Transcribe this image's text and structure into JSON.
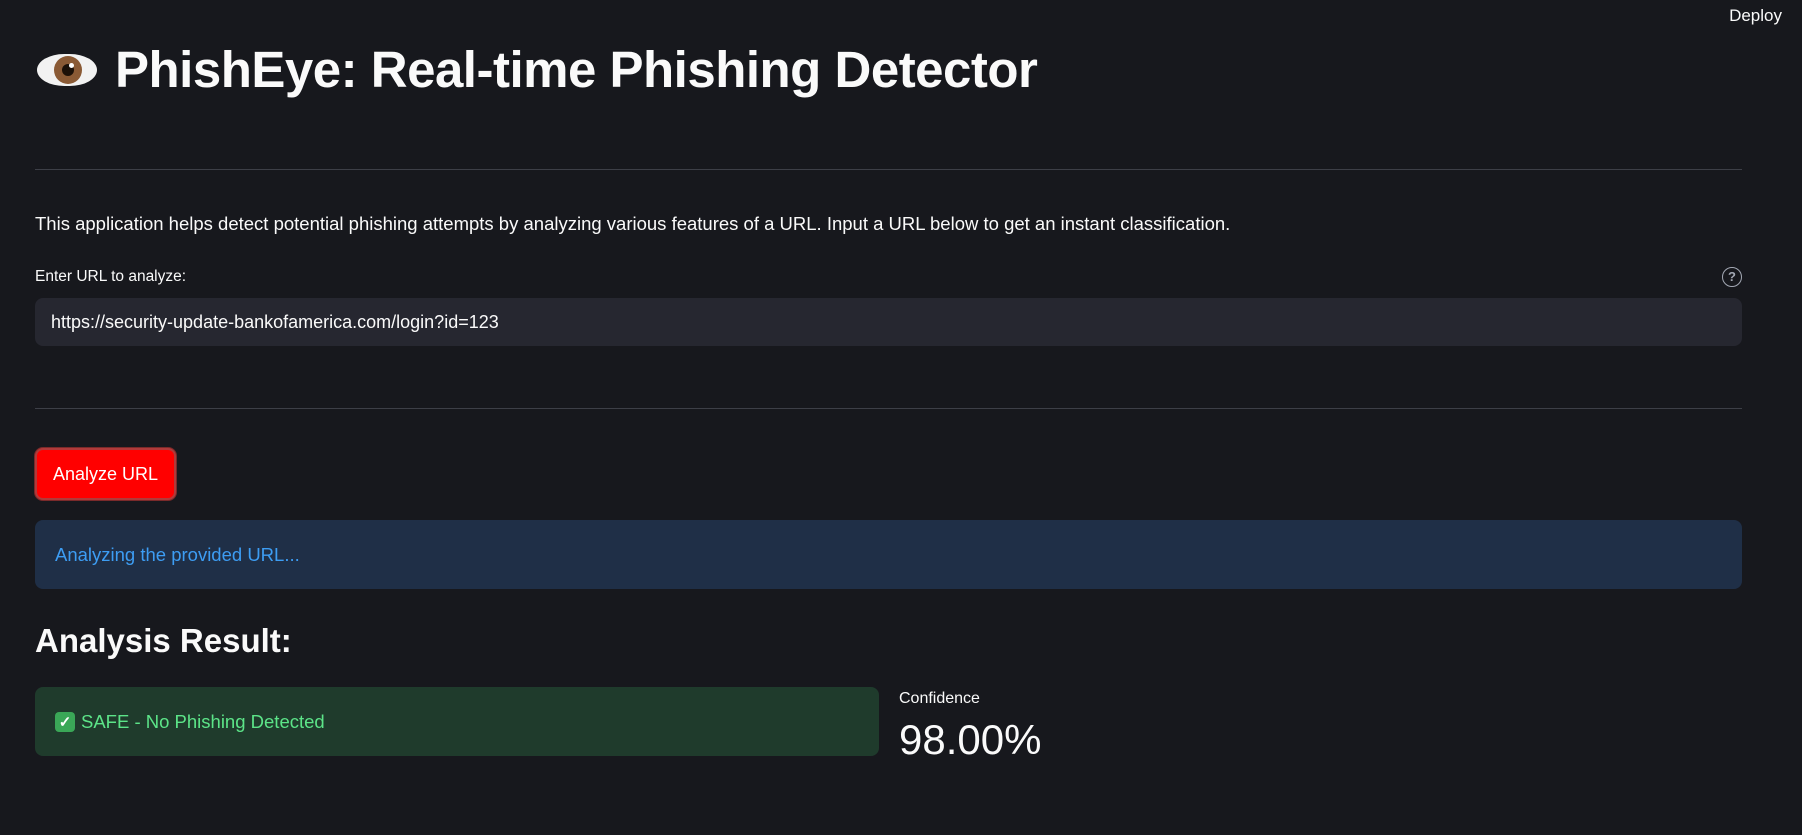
{
  "header": {
    "deploy_label": "Deploy"
  },
  "title": {
    "icon": "eye-icon",
    "text": "PhishEye: Real-time Phishing Detector"
  },
  "intro": {
    "text": "This application helps detect potential phishing attempts by analyzing various features of a URL. Input a URL below to get an instant classification."
  },
  "url_input": {
    "label": "Enter URL to analyze:",
    "value": "https://security-update-bankofamerica.com/login?id=123",
    "help_icon": "question-circle-icon"
  },
  "analyze_button": {
    "label": "Analyze URL",
    "color": "#ff0000"
  },
  "info": {
    "text": "Analyzing the provided URL..."
  },
  "result": {
    "heading": "Analysis Result:",
    "status_icon": "check-mark-icon",
    "status_text": "SAFE - No Phishing Detected",
    "status_color": "#5ce488"
  },
  "metric": {
    "label": "Confidence",
    "value": "98.00%"
  }
}
